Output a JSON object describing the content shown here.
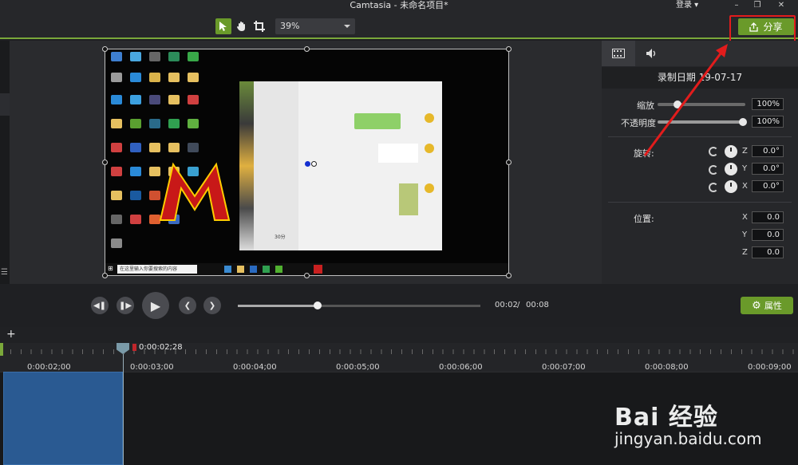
{
  "window": {
    "title": "Camtasia - 未命名项目*",
    "login_label": "登录",
    "minimize": "–",
    "restore": "❐",
    "close": "✕"
  },
  "toolbar": {
    "zoom_value": "39%",
    "share_label": "分享",
    "share_icon": "upload-icon"
  },
  "preview": {
    "desktop_search_placeholder": "在这里输入你要搜索的内容",
    "chat_text": "30分"
  },
  "properties": {
    "header_title": "录制日期 19-07-17",
    "scale_label": "缩放",
    "scale_value": "100%",
    "scale_level": 1.0,
    "opacity_label": "不透明度",
    "opacity_value": "100%",
    "opacity_level": 1.0,
    "rotation_label": "旋转:",
    "rotation": [
      {
        "axis": "Z",
        "value": "0.0°"
      },
      {
        "axis": "Y",
        "value": "0.0°"
      },
      {
        "axis": "X",
        "value": "0.0°"
      }
    ],
    "position_label": "位置:",
    "position": [
      {
        "axis": "X",
        "value": "0.0"
      },
      {
        "axis": "Y",
        "value": "0.0"
      },
      {
        "axis": "Z",
        "value": "0.0"
      }
    ]
  },
  "playback": {
    "current_time": "00:02",
    "separator": "/",
    "total_time": "00:08",
    "progress": 0.33,
    "properties_button": "属性"
  },
  "timeline": {
    "add_label": "+",
    "playhead_time": "0:00:02;28",
    "ruler_labels": [
      "0:00:02;00",
      "0:00:03;00",
      "0:00:04;00",
      "0:00:05;00",
      "0:00:06;00",
      "0:00:07;00",
      "0:00:08;00",
      "0:00:09;00"
    ]
  },
  "watermark": {
    "logo": "Bai 经验",
    "url": "jingyan.baidu.com"
  },
  "colors": {
    "accent_green": "#6a9a2a",
    "annotation_red": "#e21c1c",
    "clip_blue": "#2a5a92"
  }
}
